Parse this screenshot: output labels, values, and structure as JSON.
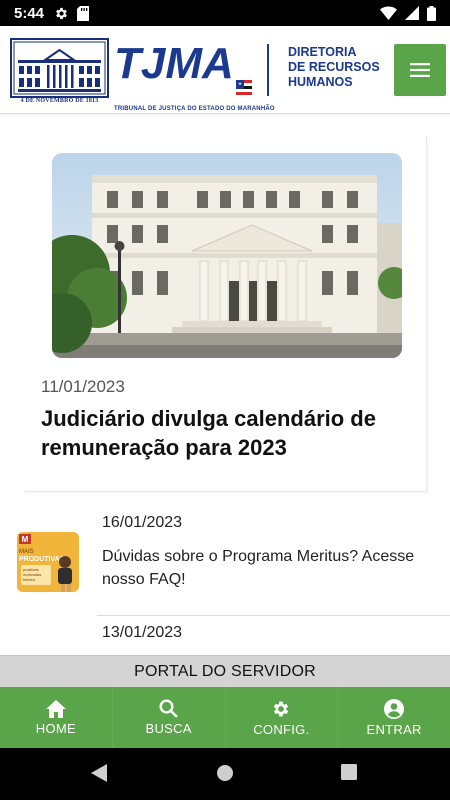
{
  "status_bar": {
    "time": "5:44",
    "left_icons": [
      "gear-icon",
      "sd-card-icon"
    ],
    "right_icons": [
      "wifi-icon",
      "signal-icon",
      "battery-icon"
    ]
  },
  "header": {
    "building_caption": "4 DE NOVEMBRO DE 1813",
    "logo_text": "TJMA",
    "logo_caption": "TRIBUNAL DE JUSTIÇA DO ESTADO DO MARANHÃO",
    "department_lines": [
      "DIRETORIA",
      "DE RECURSOS",
      "HUMANOS"
    ],
    "menu_icon": "hamburger-menu-icon",
    "brand_blue": "#1b3a8f",
    "brand_green": "#5aa54a"
  },
  "featured": {
    "date": "11/01/2023",
    "title": "Judiciário divulga calendário de remuneração para 2023",
    "image": "courthouse-building-photo"
  },
  "news": [
    {
      "date": "16/01/2023",
      "title": "Dúvidas sobre o Programa Meritus? Acesse nosso FAQ!",
      "thumb_text": [
        "M",
        "MAIS",
        "PRODUTIVAS",
        "positivas",
        "motivadas",
        "felizes!"
      ]
    },
    {
      "date": "13/01/2023",
      "title": ""
    }
  ],
  "portal": {
    "label": "PORTAL DO SERVIDOR"
  },
  "bottom_nav": [
    {
      "label": "HOME",
      "icon": "home-icon"
    },
    {
      "label": "BUSCA",
      "icon": "search-icon"
    },
    {
      "label": "CONFIG.",
      "icon": "gear-icon"
    },
    {
      "label": "ENTRAR",
      "icon": "account-icon"
    }
  ],
  "system_nav": [
    "back-icon",
    "home-circle-icon",
    "recents-icon"
  ]
}
